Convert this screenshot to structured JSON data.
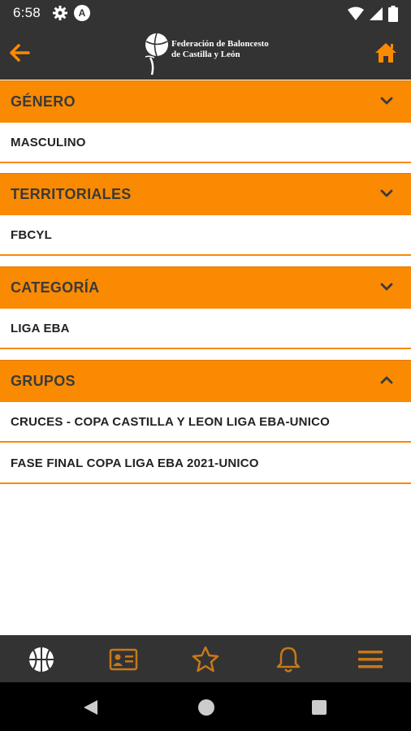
{
  "status": {
    "time": "6:58",
    "icons": [
      "settings-icon",
      "a-badge-icon",
      "wifi-icon",
      "signal-icon",
      "battery-icon"
    ]
  },
  "header": {
    "logo_line1": "Federación de Baloncesto",
    "logo_line2": "de Castilla y León",
    "icons": [
      "back-arrow-icon",
      "home-icon"
    ],
    "accent": "#f98a02"
  },
  "sections": [
    {
      "title": "GÉNERO",
      "expanded": false,
      "items": [
        "MASCULINO"
      ]
    },
    {
      "title": "TERRITORIALES",
      "expanded": false,
      "items": [
        "FBCYL"
      ]
    },
    {
      "title": "CATEGORÍA",
      "expanded": false,
      "items": [
        "LIGA EBA"
      ]
    },
    {
      "title": "GRUPOS",
      "expanded": true,
      "items": [
        "CRUCES - COPA CASTILLA Y LEON LIGA EBA-UNICO",
        "FASE FINAL COPA LIGA EBA 2021-UNICO"
      ]
    }
  ],
  "bottom_nav": {
    "items": [
      "basketball-icon",
      "id-card-icon",
      "star-icon",
      "bell-icon",
      "menu-icon"
    ],
    "active": "basketball-icon",
    "active_color": "#ffffff",
    "inactive_color": "#c8781a"
  },
  "system_nav": [
    "back-triangle-icon",
    "home-circle-icon",
    "recents-square-icon"
  ]
}
